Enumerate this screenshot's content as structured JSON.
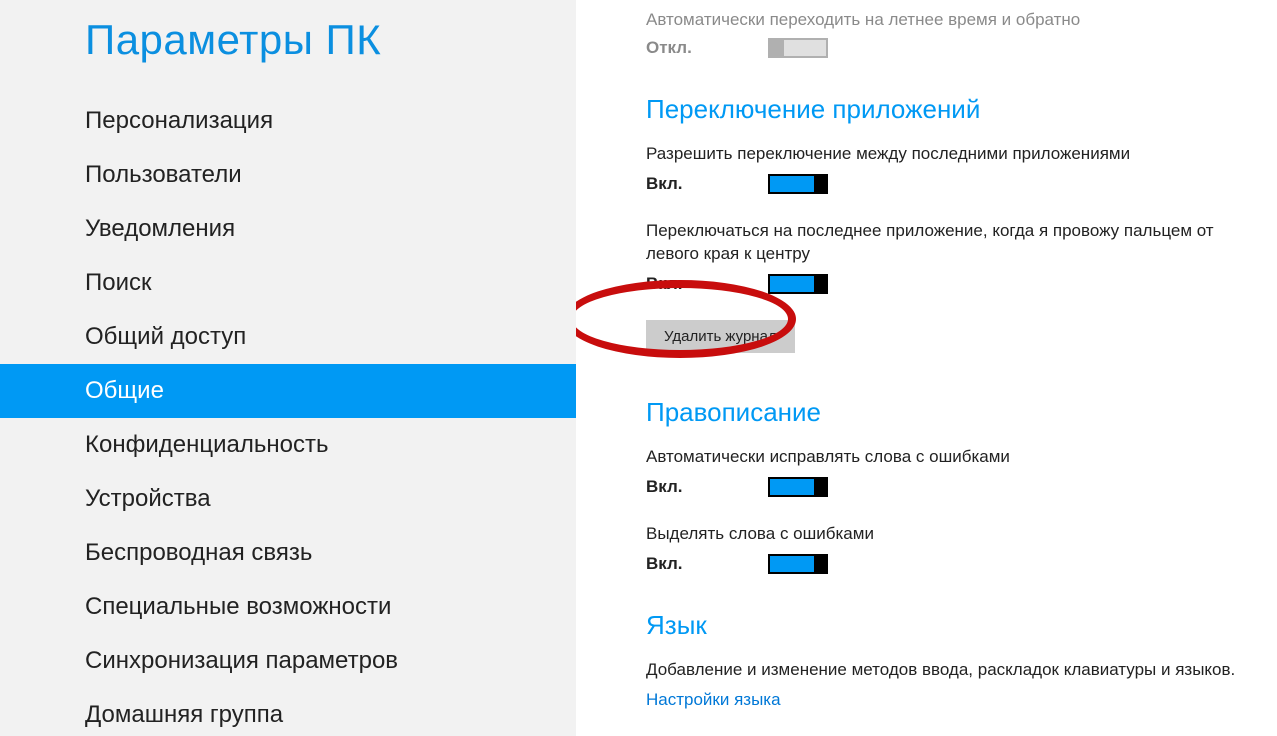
{
  "sidebar": {
    "title": "Параметры ПК",
    "items": [
      {
        "label": "Персонализация"
      },
      {
        "label": "Пользователи"
      },
      {
        "label": "Уведомления"
      },
      {
        "label": "Поиск"
      },
      {
        "label": "Общий доступ"
      },
      {
        "label": "Общие"
      },
      {
        "label": "Конфиденциальность"
      },
      {
        "label": "Устройства"
      },
      {
        "label": "Беспроводная связь"
      },
      {
        "label": "Специальные возможности"
      },
      {
        "label": "Синхронизация параметров"
      },
      {
        "label": "Домашняя группа"
      }
    ],
    "selected_index": 5
  },
  "content": {
    "dst": {
      "desc": "Автоматически переходить на летнее время и обратно",
      "state_label": "Откл.",
      "state": "off"
    },
    "app_switch": {
      "title": "Переключение приложений",
      "setting1": {
        "desc": "Разрешить переключение между последними приложениями",
        "state_label": "Вкл.",
        "state": "on"
      },
      "setting2": {
        "desc": "Переключаться на последнее приложение, когда я провожу пальцем от левого края к центру",
        "state_label": "Вкл.",
        "state": "on"
      },
      "delete_button": "Удалить журнал"
    },
    "spelling": {
      "title": "Правописание",
      "setting1": {
        "desc": "Автоматически исправлять слова с ошибками",
        "state_label": "Вкл.",
        "state": "on"
      },
      "setting2": {
        "desc": "Выделять слова с ошибками",
        "state_label": "Вкл.",
        "state": "on"
      }
    },
    "language": {
      "title": "Язык",
      "desc": "Добавление и изменение методов ввода, раскладок клавиатуры и языков.",
      "link": "Настройки языка"
    }
  },
  "colors": {
    "accent": "#0099f4",
    "annotation": "#c80d0d"
  }
}
